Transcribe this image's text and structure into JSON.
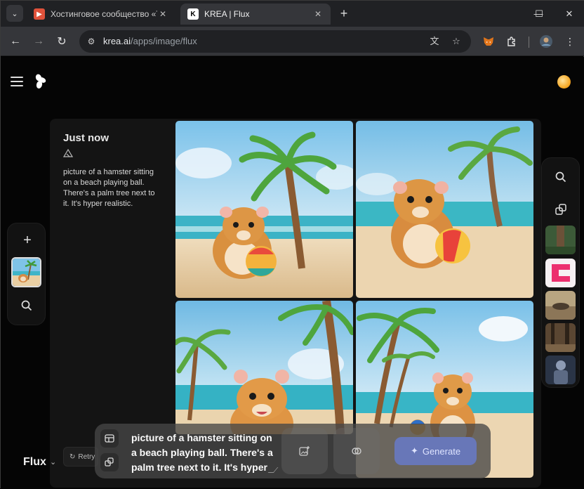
{
  "browser": {
    "tabs": [
      {
        "title": "Хостинговое сообщество «Tim",
        "icon": "favicon-youtube-like"
      },
      {
        "title": "KREA | Flux",
        "icon": "favicon-krea"
      }
    ],
    "new_tab_label": "+",
    "url_domain": "krea.ai",
    "url_path": "/apps/image/flux",
    "window_controls": {
      "minimize": "—",
      "maximize": "☐",
      "close": "✕"
    }
  },
  "app": {
    "logo": "krea-logo",
    "generation": {
      "time_label": "Just now",
      "prompt": "picture of a hamster sitting on a beach playing ball. There's a palm tree next to it. It's hyper realistic.",
      "retry_label": "Retry"
    },
    "model": {
      "name": "Flux"
    },
    "prompt_bar": {
      "input_value": "picture of a hamster sitting on a beach playing ball. There's a palm tree next to it. It's hyper realistic.",
      "generate_label": "Generate"
    },
    "accent_color": "#6877b8"
  }
}
